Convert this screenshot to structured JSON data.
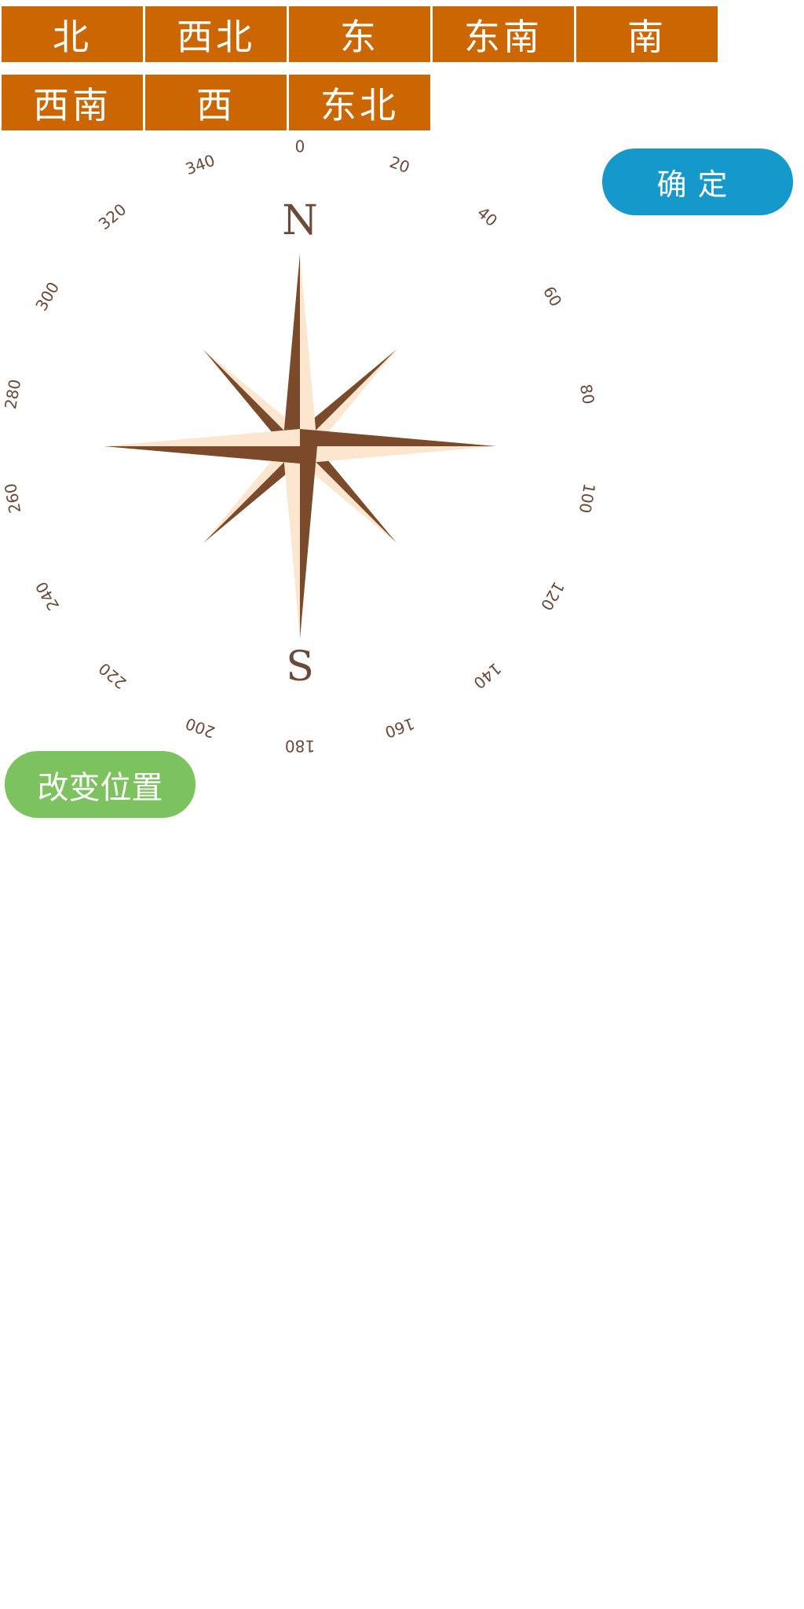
{
  "direction_buttons": [
    {
      "label": "北"
    },
    {
      "label": "西北"
    },
    {
      "label": "东"
    },
    {
      "label": "东南"
    },
    {
      "label": "南"
    },
    {
      "label": "西南"
    },
    {
      "label": "西"
    },
    {
      "label": "东北"
    }
  ],
  "confirm_button": {
    "label": "确定"
  },
  "change_position_button": {
    "label": "改变位置"
  },
  "compass": {
    "north_label": "N",
    "south_label": "S",
    "degree_labels": [
      "0",
      "20",
      "40",
      "60",
      "80",
      "100",
      "120",
      "140",
      "160",
      "180",
      "200",
      "220",
      "240",
      "260",
      "280",
      "300",
      "320",
      "340"
    ],
    "colors": {
      "dark_point": "#7a4a2a",
      "light_point": "#fde6cf",
      "text": "#6b4a3a"
    }
  },
  "colors": {
    "direction_button_bg": "#cc6600",
    "confirm_button_bg": "#1599cb",
    "change_button_bg": "#7cc35f"
  }
}
